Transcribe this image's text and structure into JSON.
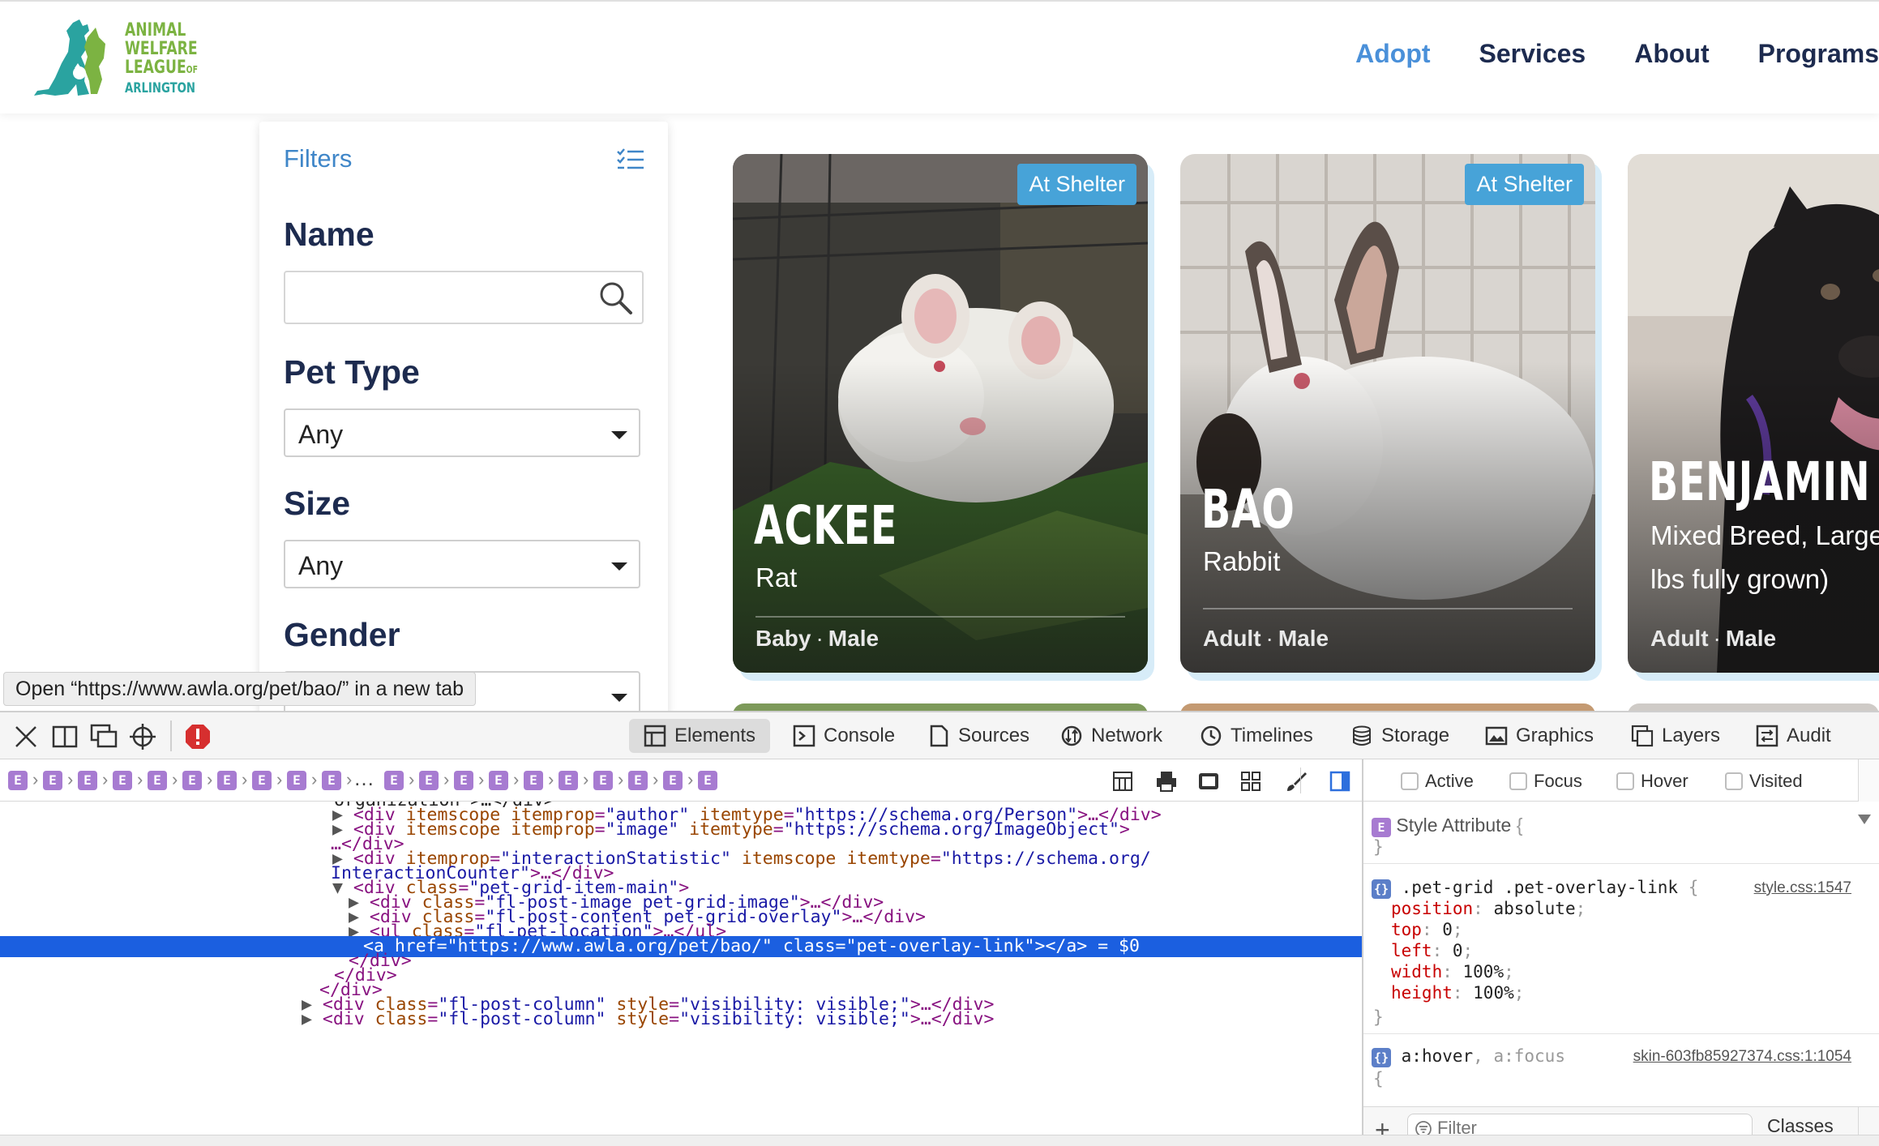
{
  "logo": {
    "lines": [
      "ANIMAL",
      "WELFARE",
      "LEAGUE",
      "ARLINGTON"
    ],
    "of": "OF",
    "colors": {
      "green": "#7cb342",
      "teal": "#2aa3a0"
    }
  },
  "nav": {
    "items": [
      "Adopt",
      "Services",
      "About",
      "Programs"
    ],
    "active": "Adopt",
    "active_color": "#4a90d9"
  },
  "filters": {
    "title": "Filters",
    "name_label": "Name",
    "name_value": "",
    "pet_type_label": "Pet Type",
    "pet_type_value": "Any",
    "size_label": "Size",
    "size_value": "Any",
    "gender_label": "Gender"
  },
  "pets": [
    {
      "badge": "At Shelter",
      "name": "ACKEE",
      "species": "Rat",
      "age": "Baby",
      "sex": "Male"
    },
    {
      "badge": "At Shelter",
      "name": "BAO",
      "species": "Rabbit",
      "age": "Adult",
      "sex": "Male"
    },
    {
      "badge": "",
      "name": "BENJAMIN",
      "species_line1": "Mixed Breed, Large",
      "species_line2": "lbs fully grown)",
      "age": "Adult",
      "sex": "Male"
    }
  ],
  "tooltip": "Open “https://www.awla.org/pet/bao/” in a new tab",
  "devtools": {
    "tabs": [
      "Elements",
      "Console",
      "Sources",
      "Network",
      "Timelines",
      "Storage",
      "Graphics",
      "Layers",
      "Audit"
    ],
    "active_tab": "Elements",
    "crumb_letter": "E",
    "ellipsis": "…",
    "pseudo": [
      "Active",
      "Focus",
      "Hover",
      "Visited"
    ],
    "dom": {
      "l0": "organization\">…</div>",
      "l1": {
        "tag_open": "<div ",
        "a1": "itemscope ",
        "a2": "itemprop",
        "v2": "\"author\"",
        "a3": "itemtype",
        "v3": "\"https://schema.org/Person\"",
        "close": ">…</div>"
      },
      "l2": {
        "tag_open": "<div ",
        "a1": "itemscope ",
        "a2": "itemprop",
        "v2": "\"image\"",
        "a3": "itemtype",
        "v3": "\"https://schema.org/ImageObject\"",
        "close": ">"
      },
      "l3": "…</div>",
      "l4": {
        "tag_open": "<div ",
        "a1": "itemprop",
        "v1": "\"interactionStatistic\"",
        "a2": " itemscope ",
        "a3": "itemtype",
        "v3": "\"https://schema.org/"
      },
      "l5": {
        "v": "InteractionCounter\"",
        "close": ">…</div>"
      },
      "l6": {
        "tag_open": "<div ",
        "a1": "class",
        "v1": "\"pet-grid-item-main\"",
        "close": ">"
      },
      "l7": {
        "tag_open": "<div ",
        "a1": "class",
        "v1": "\"fl-post-image pet-grid-image\"",
        "close": ">…</div>"
      },
      "l8": {
        "tag_open": "<div ",
        "a1": "class",
        "v1": "\"fl-post-content pet-grid-overlay\"",
        "close": ">…</div>"
      },
      "l9": {
        "tag_open": "<ul ",
        "a1": "class",
        "v1": "\"fl-pet-location\"",
        "close": ">…</ul>"
      },
      "l10": {
        "tag_open": "<a ",
        "a1": "href",
        "v1": "\"https://www.awla.org/pet/bao/\"",
        "a2": "class",
        "v2": "\"pet-overlay-link\"",
        "close": "></a> = $0"
      },
      "l11": "</div>",
      "l12": "</div>",
      "l13": "</div>",
      "l14": {
        "tag_open": "<div ",
        "a1": "class",
        "v1": "\"fl-post-column\"",
        "a2": "style",
        "v2": "\"visibility: visible;\"",
        "close": ">…</div>"
      },
      "l15": {
        "tag_open": "<div ",
        "a1": "class",
        "v1": "\"fl-post-column\"",
        "a2": "style",
        "v2": "\"visibility: visible;\"",
        "close": ">…</div>"
      }
    },
    "styles": {
      "style_attribute": "Style Attribute",
      "rule1_selector": ".pet-grid .pet-overlay-link",
      "rule1_source": "style.css:1547",
      "rule1_props": [
        {
          "name": "position",
          "value": "absolute"
        },
        {
          "name": "top",
          "value": "0"
        },
        {
          "name": "left",
          "value": "0"
        },
        {
          "name": "width",
          "value": "100%"
        },
        {
          "name": "height",
          "value": "100%"
        }
      ],
      "rule2_selector_a": "a:hover",
      "rule2_selector_b": "a:focus",
      "rule2_source": "skin-603fb85927374.css:1:1054",
      "filter_placeholder": "Filter",
      "classes_label": "Classes"
    }
  }
}
